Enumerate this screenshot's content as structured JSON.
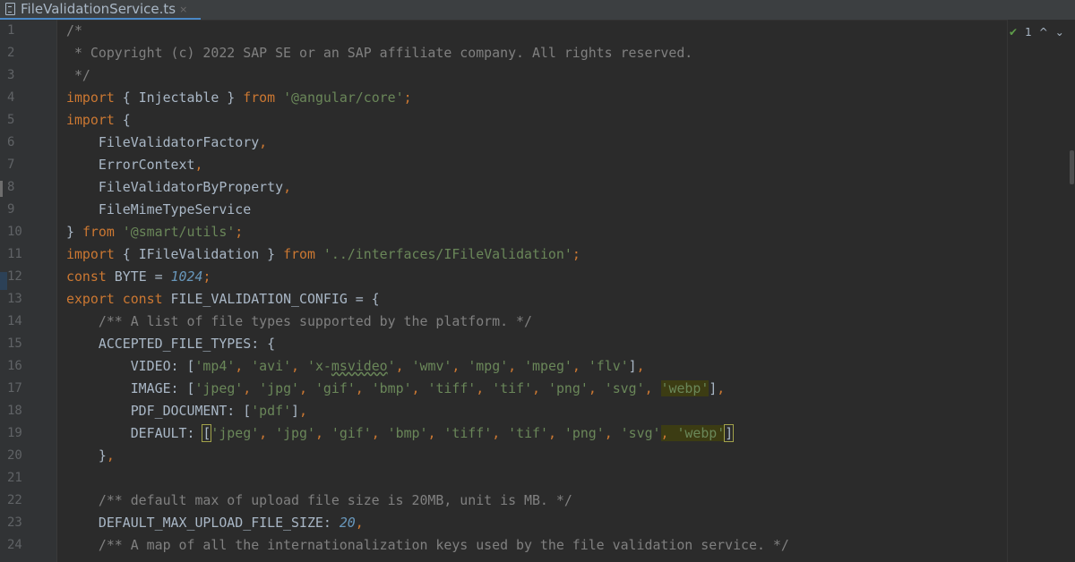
{
  "tab": {
    "title": "FileValidationService.ts",
    "close": "×"
  },
  "inspection": {
    "count": "1",
    "up": "^",
    "down": "⌄"
  },
  "line_numbers": [
    "1",
    "2",
    "3",
    "4",
    "5",
    "6",
    "7",
    "8",
    "9",
    "10",
    "11",
    "12",
    "13",
    "14",
    "15",
    "16",
    "17",
    "18",
    "19",
    "20",
    "21",
    "22",
    "23",
    "24"
  ],
  "code_lines": [
    [
      {
        "t": "/*",
        "c": "cm"
      }
    ],
    [
      {
        "t": " * Copyright (c) 2022 SAP SE or an SAP affiliate company. All rights reserved.",
        "c": "cm"
      }
    ],
    [
      {
        "t": " */",
        "c": "cm"
      }
    ],
    [
      {
        "t": "import",
        "c": "kw"
      },
      {
        "t": " { Injectable } "
      },
      {
        "t": "from",
        "c": "kw"
      },
      {
        "t": " "
      },
      {
        "t": "'@angular/core'",
        "c": "str"
      },
      {
        "t": ";",
        "c": "kw"
      }
    ],
    [
      {
        "t": "import",
        "c": "kw"
      },
      {
        "t": " {"
      }
    ],
    [
      {
        "t": "    FileValidatorFactory"
      },
      {
        "t": ",",
        "c": "kw"
      }
    ],
    [
      {
        "t": "    ErrorContext"
      },
      {
        "t": ",",
        "c": "kw"
      }
    ],
    [
      {
        "t": "    FileValidatorByProperty"
      },
      {
        "t": ",",
        "c": "kw"
      }
    ],
    [
      {
        "t": "    FileMimeTypeService"
      }
    ],
    [
      {
        "t": "} "
      },
      {
        "t": "from",
        "c": "kw"
      },
      {
        "t": " "
      },
      {
        "t": "'@smart/utils'",
        "c": "str"
      },
      {
        "t": ";",
        "c": "kw"
      }
    ],
    [
      {
        "t": "import",
        "c": "kw"
      },
      {
        "t": " { IFileValidation } "
      },
      {
        "t": "from",
        "c": "kw"
      },
      {
        "t": " "
      },
      {
        "t": "'../interfaces/IFileValidation'",
        "c": "str"
      },
      {
        "t": ";",
        "c": "kw"
      }
    ],
    [
      {
        "t": "const",
        "c": "kw"
      },
      {
        "t": " BYTE = "
      },
      {
        "t": "1024",
        "c": "num"
      },
      {
        "t": ";",
        "c": "kw"
      }
    ],
    [
      {
        "t": "export const",
        "c": "kw"
      },
      {
        "t": " FILE_VALIDATION_CONFIG = {"
      }
    ],
    [
      {
        "t": "    /** A list of file types supported by the platform. */",
        "c": "cm"
      }
    ],
    [
      {
        "t": "    ACCEPTED_FILE_TYPES: {"
      }
    ],
    [
      {
        "t": "        VIDEO: ["
      },
      {
        "t": "'mp4'",
        "c": "str"
      },
      {
        "t": ", ",
        "c": "kw"
      },
      {
        "t": "'avi'",
        "c": "str"
      },
      {
        "t": ", ",
        "c": "kw"
      },
      {
        "t": "'x-",
        "c": "str"
      },
      {
        "t": "msvideo",
        "c": "str typo"
      },
      {
        "t": "'",
        "c": "str"
      },
      {
        "t": ", ",
        "c": "kw"
      },
      {
        "t": "'wmv'",
        "c": "str"
      },
      {
        "t": ", ",
        "c": "kw"
      },
      {
        "t": "'mpg'",
        "c": "str"
      },
      {
        "t": ", ",
        "c": "kw"
      },
      {
        "t": "'mpeg'",
        "c": "str"
      },
      {
        "t": ", ",
        "c": "kw"
      },
      {
        "t": "'flv'",
        "c": "str"
      },
      {
        "t": "]"
      },
      {
        "t": ",",
        "c": "kw"
      }
    ],
    [
      {
        "t": "        IMAGE: ["
      },
      {
        "t": "'jpeg'",
        "c": "str"
      },
      {
        "t": ", ",
        "c": "kw"
      },
      {
        "t": "'jpg'",
        "c": "str"
      },
      {
        "t": ", ",
        "c": "kw"
      },
      {
        "t": "'gif'",
        "c": "str"
      },
      {
        "t": ", ",
        "c": "kw"
      },
      {
        "t": "'bmp'",
        "c": "str"
      },
      {
        "t": ", ",
        "c": "kw"
      },
      {
        "t": "'tiff'",
        "c": "str"
      },
      {
        "t": ", ",
        "c": "kw"
      },
      {
        "t": "'tif'",
        "c": "str"
      },
      {
        "t": ", ",
        "c": "kw"
      },
      {
        "t": "'png'",
        "c": "str"
      },
      {
        "t": ", ",
        "c": "kw"
      },
      {
        "t": "'svg'",
        "c": "str"
      },
      {
        "t": ", ",
        "c": "kw"
      },
      {
        "t": "'webp'",
        "c": "str hl"
      },
      {
        "t": "]"
      },
      {
        "t": ",",
        "c": "kw"
      }
    ],
    [
      {
        "t": "        PDF_DOCUMENT: ["
      },
      {
        "t": "'pdf'",
        "c": "str"
      },
      {
        "t": "]"
      },
      {
        "t": ",",
        "c": "kw"
      }
    ],
    [
      {
        "t": "        DEFAULT: "
      },
      {
        "t": "[",
        "c": "brkmatch"
      },
      {
        "t": "'jpeg'",
        "c": "str"
      },
      {
        "t": ", ",
        "c": "kw"
      },
      {
        "t": "'jpg'",
        "c": "str"
      },
      {
        "t": ", ",
        "c": "kw"
      },
      {
        "t": "'gif'",
        "c": "str"
      },
      {
        "t": ", ",
        "c": "kw"
      },
      {
        "t": "'bmp'",
        "c": "str"
      },
      {
        "t": ", ",
        "c": "kw"
      },
      {
        "t": "'tiff'",
        "c": "str"
      },
      {
        "t": ", ",
        "c": "kw"
      },
      {
        "t": "'tif'",
        "c": "str"
      },
      {
        "t": ", ",
        "c": "kw"
      },
      {
        "t": "'png'",
        "c": "str"
      },
      {
        "t": ", ",
        "c": "kw"
      },
      {
        "t": "'svg'",
        "c": "str"
      },
      {
        "t": ", ",
        "c": "kw hl"
      },
      {
        "t": "'webp'",
        "c": "str hl"
      },
      {
        "t": "]",
        "c": "brkmatch"
      }
    ],
    [
      {
        "t": "    }"
      },
      {
        "t": ",",
        "c": "kw"
      }
    ],
    [
      {
        "t": ""
      }
    ],
    [
      {
        "t": "    /** default max of upload file size is 20MB, unit is MB. */",
        "c": "cm"
      }
    ],
    [
      {
        "t": "    DEFAULT_MAX_UPLOAD_FILE_SIZE: "
      },
      {
        "t": "20",
        "c": "num"
      },
      {
        "t": ",",
        "c": "kw"
      }
    ],
    [
      {
        "t": "    /** A map of all the internationalization keys used by the file validation service. */",
        "c": "cm"
      }
    ]
  ]
}
